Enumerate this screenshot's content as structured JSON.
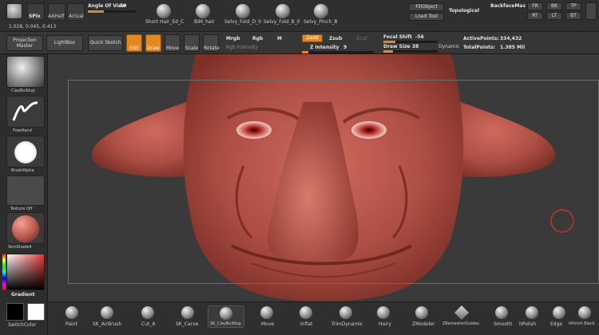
{
  "header": {
    "readout": "1.028, 0.045, 0.413",
    "spix": "SPix",
    "aahalf": "AAHalf",
    "actual": "Actual",
    "angle_of_view_label": "Angle Of View",
    "angle_of_view_value": "50",
    "brushes": [
      "Short Hair_Ed_C",
      "BiM_hair",
      "Selvy_Fold_D_0",
      "Selvy_Fold_B_0",
      "Selvy_Pinch_B"
    ],
    "fill_object": "FillObject",
    "load_tool": "Load Tool",
    "topological": "Topological",
    "backface_mask": "BackfaceMas",
    "view_buttons": [
      "FR",
      "BK",
      "TP",
      "RT",
      "LT",
      "BT"
    ]
  },
  "toolbar": {
    "projection_master": "Projection Master",
    "lightbox": "LightBox",
    "quick_sketch": "Quick Sketch",
    "edit": "Edit",
    "draw": "Draw",
    "move": "Move",
    "scale": "Scale",
    "rotate": "Rotate",
    "mrgb": "Mrgb",
    "rgb": "Rgb",
    "m": "M",
    "rgb_intensity": "Rgb Intensity",
    "zadd": "Zadd",
    "zsub": "Zsub",
    "zcut": "Zcut",
    "z_intensity_label": "Z Intensity",
    "z_intensity_value": "9",
    "z_intensity_fraction": 0.09,
    "focal_shift_label": "Focal Shift",
    "focal_shift_value": "-56",
    "draw_size_label": "Draw Size",
    "draw_size_value": "38",
    "dynamic": "Dynamic",
    "active_points_label": "ActivePoints:",
    "active_points_value": "334,432",
    "total_points_label": "TotalPoints:",
    "total_points_value": "1.385 Mil"
  },
  "left": {
    "brush": "ClayBuildup",
    "stroke": "FreeHand",
    "alpha": "BrushAlpha",
    "texture": "Texture Off",
    "material": "SkinShade4",
    "gradient": "Gradient",
    "switch_color": "SwitchColor"
  },
  "tray": {
    "brushes": [
      "Paint",
      "SK_AirBrush",
      "Cut_A",
      "SK_Carve",
      "SK_ClayBuildup",
      "Move",
      "Inflat",
      "TrimDynamic",
      "Hairy",
      "ZModeler",
      "ZRemesherGuides",
      "Smooth",
      "hPolish",
      "Edge",
      "hPolish Black"
    ]
  },
  "colors": {
    "accent": "#e4871f",
    "skin": "#b8564c",
    "background": "#3a3a3a"
  }
}
